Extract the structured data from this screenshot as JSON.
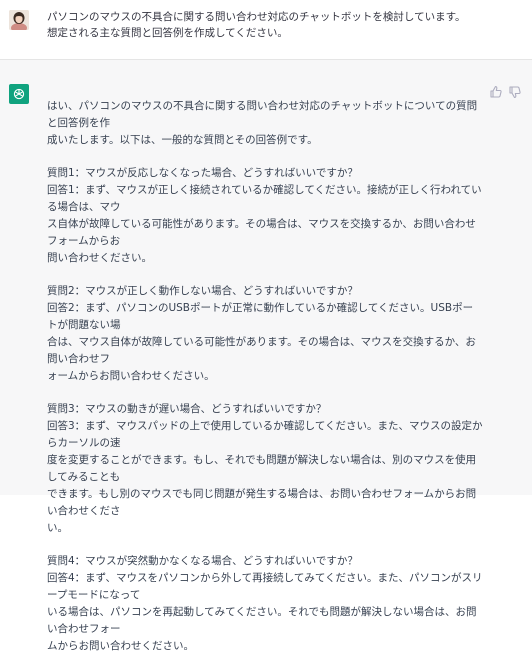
{
  "user_message": {
    "lines": [
      "パソコンのマウスの不具合に関する問い合わせ対応のチャットボットを検討しています。",
      "想定される主な質問と回答例を作成してください。"
    ]
  },
  "bot_message": {
    "intro": [
      "はい、パソコンのマウスの不具合に関する問い合わせ対応のチャットボットについての質問と回答例を作",
      "成いたします。以下は、一般的な質問とその回答例です。"
    ],
    "qa": [
      {
        "lines": [
          "質問1：マウスが反応しなくなった場合、どうすればいいですか？",
          "回答1：まず、マウスが正しく接続されているか確認してください。接続が正しく行われている場合は、マウ",
          "ス自体が故障している可能性があります。その場合は、マウスを交換するか、お問い合わせフォームからお",
          "問い合わせください。"
        ]
      },
      {
        "lines": [
          "質問2：マウスが正しく動作しない場合、どうすればいいですか？",
          "回答2：まず、パソコンのUSBポートが正常に動作しているか確認してください。USBポートが問題ない場",
          "合は、マウス自体が故障している可能性があります。その場合は、マウスを交換するか、お問い合わせフ",
          "ォームからお問い合わせください。"
        ]
      },
      {
        "lines": [
          "質問3：マウスの動きが遅い場合、どうすればいいですか？",
          "回答3：まず、マウスパッドの上で使用しているか確認してください。また、マウスの設定からカーソルの速",
          "度を変更することができます。もし、それでも問題が解決しない場合は、別のマウスを使用してみることも",
          "できます。もし別のマウスでも同じ問題が発生する場合は、お問い合わせフォームからお問い合わせくださ",
          "い。"
        ]
      },
      {
        "lines": [
          "質問4：マウスが突然動かなくなる場合、どうすればいいですか？",
          "回答4：まず、マウスをパソコンから外して再接続してみてください。また、パソコンがスリープモードになって",
          "いる場合は、パソコンを再起動してみてください。それでも問題が解決しない場合は、お問い合わせフォー",
          "ムからお問い合わせください。"
        ]
      }
    ]
  },
  "icons": {
    "bot_logo": "openai-logo-icon",
    "thumbs_up": "thumbs-up-icon",
    "thumbs_down": "thumbs-down-icon",
    "avatar": "user-avatar"
  },
  "colors": {
    "bot_logo_bg": "#10a37f",
    "bot_row_bg": "#f7f7f8"
  }
}
